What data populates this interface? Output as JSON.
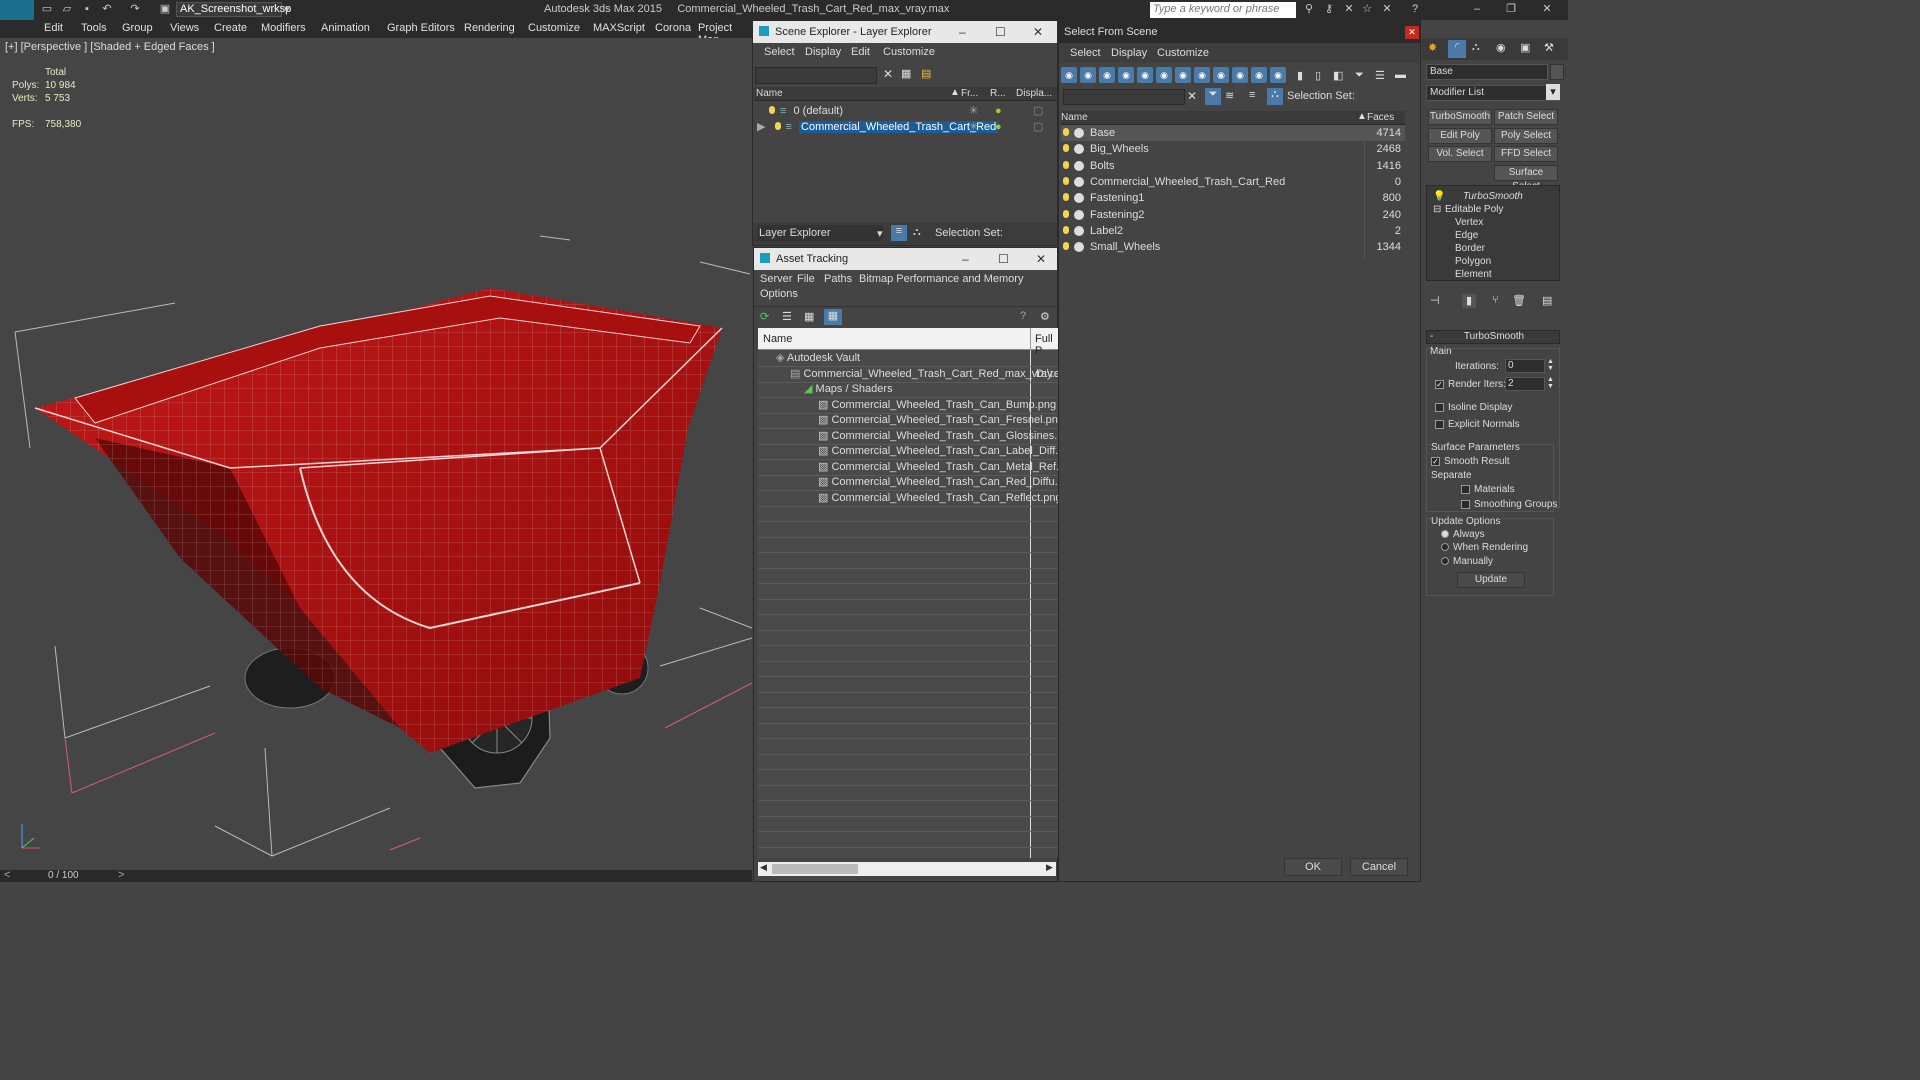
{
  "window": {
    "app_title": "Autodesk 3ds Max  2015",
    "file_title": "Commercial_Wheeled_Trash_Cart_Red_max_vray.max",
    "workspace": "AK_Screenshot_wrksp",
    "search_placeholder": "Type a keyword or phrase",
    "logo": "MAX"
  },
  "menu": [
    "Edit",
    "Tools",
    "Group",
    "Views",
    "Create",
    "Modifiers",
    "Animation",
    "Graph Editors",
    "Rendering",
    "Customize",
    "MAXScript",
    "Corona",
    "Project Man"
  ],
  "viewport": {
    "label": "[+] [Perspective ] [Shaded + Edged Faces ]",
    "stats_total": "Total",
    "polys_label": "Polys:",
    "polys_value": "10 984",
    "verts_label": "Verts:",
    "verts_value": "5 753",
    "fps_label": "FPS:",
    "fps_value": "758,380"
  },
  "timeline": {
    "frame": "0 / 100"
  },
  "scene_explorer": {
    "title": "Scene Explorer - Layer Explorer",
    "menu": [
      "Select",
      "Display",
      "Edit",
      "Customize"
    ],
    "columns": [
      "Name",
      "Fr...",
      "R...",
      "Displa..."
    ],
    "rows": [
      "0 (default)",
      "Commercial_Wheeled_Trash_Cart_Red"
    ],
    "footer_label": "Layer Explorer",
    "selection_set": "Selection Set:"
  },
  "asset_tracking": {
    "title": "Asset Tracking",
    "menu": [
      "Server",
      "File",
      "Paths",
      "Bitmap Performance and Memory",
      "Options"
    ],
    "columns": [
      "Name",
      "Full P"
    ],
    "rows": [
      {
        "name": "Autodesk Vault",
        "path": ""
      },
      {
        "name": "Commercial_Wheeled_Trash_Cart_Red_max_vray....",
        "path": "D:\\re"
      },
      {
        "name": "Maps / Shaders",
        "path": ""
      },
      {
        "name": "Commercial_Wheeled_Trash_Can_Bump.png",
        "path": ""
      },
      {
        "name": "Commercial_Wheeled_Trash_Can_Fresnel.png",
        "path": ""
      },
      {
        "name": "Commercial_Wheeled_Trash_Can_Glossines...",
        "path": ""
      },
      {
        "name": "Commercial_Wheeled_Trash_Can_Label_Diff...",
        "path": ""
      },
      {
        "name": "Commercial_Wheeled_Trash_Can_Metal_Ref...",
        "path": ""
      },
      {
        "name": "Commercial_Wheeled_Trash_Can_Red_Diffu...",
        "path": ""
      },
      {
        "name": "Commercial_Wheeled_Trash_Can_Reflect.png",
        "path": ""
      }
    ]
  },
  "select_from_scene": {
    "title": "Select From Scene",
    "menu": [
      "Select",
      "Display",
      "Customize"
    ],
    "selection_set": "Selection Set:",
    "columns": [
      "Name",
      "Faces"
    ],
    "rows": [
      {
        "name": "Base",
        "faces": "4714"
      },
      {
        "name": "Big_Wheels",
        "faces": "2468"
      },
      {
        "name": "Bolts",
        "faces": "1416"
      },
      {
        "name": "Commercial_Wheeled_Trash_Cart_Red",
        "faces": "0"
      },
      {
        "name": "Fastening1",
        "faces": "800"
      },
      {
        "name": "Fastening2",
        "faces": "240"
      },
      {
        "name": "Label2",
        "faces": "2"
      },
      {
        "name": "Small_Wheels",
        "faces": "1344"
      }
    ],
    "ok": "OK",
    "cancel": "Cancel"
  },
  "command_panel": {
    "object_name": "Base",
    "modifier_list": "Modifier List",
    "buttons": [
      "TurboSmooth",
      "Patch Select",
      "Edit Poly",
      "Poly Select",
      "Vol. Select",
      "FFD Select",
      "Surface Select"
    ],
    "stack": [
      "TurboSmooth",
      "Editable Poly",
      "Vertex",
      "Edge",
      "Border",
      "Polygon",
      "Element"
    ],
    "rollout_title": "TurboSmooth",
    "main": "Main",
    "iterations_label": "Iterations:",
    "iterations_value": "0",
    "render_iters_label": "Render Iters:",
    "render_iters_value": "2",
    "isoline": "Isoline Display",
    "explicit_normals": "Explicit Normals",
    "surface_params": "Surface Parameters",
    "smooth_result": "Smooth Result",
    "separate": "Separate",
    "materials": "Materials",
    "smoothing_groups": "Smoothing Groups",
    "update_options": "Update Options",
    "always": "Always",
    "when_rendering": "When Rendering",
    "manually": "Manually",
    "update": "Update"
  }
}
